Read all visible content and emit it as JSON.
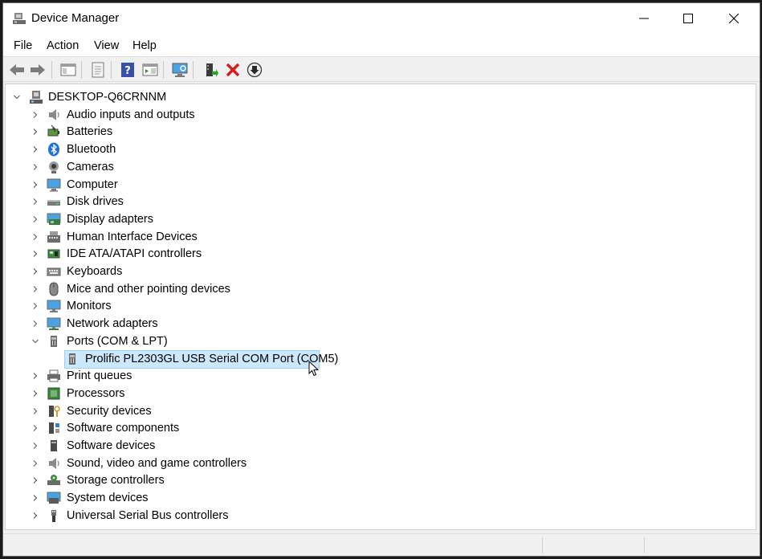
{
  "window": {
    "title": "Device Manager",
    "minimize_glyph": "—",
    "maximize_glyph": "☐",
    "close_glyph": "✕"
  },
  "menu": {
    "file": "File",
    "action": "Action",
    "view": "View",
    "help": "Help"
  },
  "toolbar": {
    "icons": [
      "back-arrow-icon",
      "forward-arrow-icon",
      "show-hide-console-tree-icon",
      "properties-icon",
      "help-icon",
      "action-pane-icon",
      "scan-hardware-changes-icon",
      "update-driver-icon",
      "uninstall-device-icon",
      "disable-device-icon"
    ]
  },
  "tree": {
    "root": "DESKTOP-Q6CRNNM",
    "categories": [
      {
        "label": "Audio inputs and outputs",
        "icon": "speaker-icon"
      },
      {
        "label": "Batteries",
        "icon": "battery-icon"
      },
      {
        "label": "Bluetooth",
        "icon": "bluetooth-icon"
      },
      {
        "label": "Cameras",
        "icon": "camera-icon"
      },
      {
        "label": "Computer",
        "icon": "computer-icon"
      },
      {
        "label": "Disk drives",
        "icon": "disk-drive-icon"
      },
      {
        "label": "Display adapters",
        "icon": "display-adapter-icon"
      },
      {
        "label": "Human Interface Devices",
        "icon": "hid-icon"
      },
      {
        "label": "IDE ATA/ATAPI controllers",
        "icon": "ide-controller-icon"
      },
      {
        "label": "Keyboards",
        "icon": "keyboard-icon"
      },
      {
        "label": "Mice and other pointing devices",
        "icon": "mouse-icon"
      },
      {
        "label": "Monitors",
        "icon": "monitor-icon"
      },
      {
        "label": "Network adapters",
        "icon": "network-adapter-icon"
      },
      {
        "label": "Ports (COM & LPT)",
        "icon": "port-icon",
        "expanded": true
      },
      {
        "label": "Print queues",
        "icon": "printer-icon"
      },
      {
        "label": "Processors",
        "icon": "processor-icon"
      },
      {
        "label": "Security devices",
        "icon": "security-device-icon"
      },
      {
        "label": "Software components",
        "icon": "software-component-icon"
      },
      {
        "label": "Software devices",
        "icon": "software-device-icon"
      },
      {
        "label": "Sound, video and game controllers",
        "icon": "sound-controller-icon"
      },
      {
        "label": "Storage controllers",
        "icon": "storage-controller-icon"
      },
      {
        "label": "System devices",
        "icon": "system-device-icon"
      },
      {
        "label": "Universal Serial Bus controllers",
        "icon": "usb-icon"
      }
    ],
    "ports_child": "Prolific PL2303GL USB Serial COM Port (COM5)"
  },
  "colors": {
    "selection_bg": "#cce8ff",
    "selection_border": "#99d1ff",
    "uninstall_red": "#d71a1a",
    "bluetooth_blue": "#1e73d8"
  }
}
